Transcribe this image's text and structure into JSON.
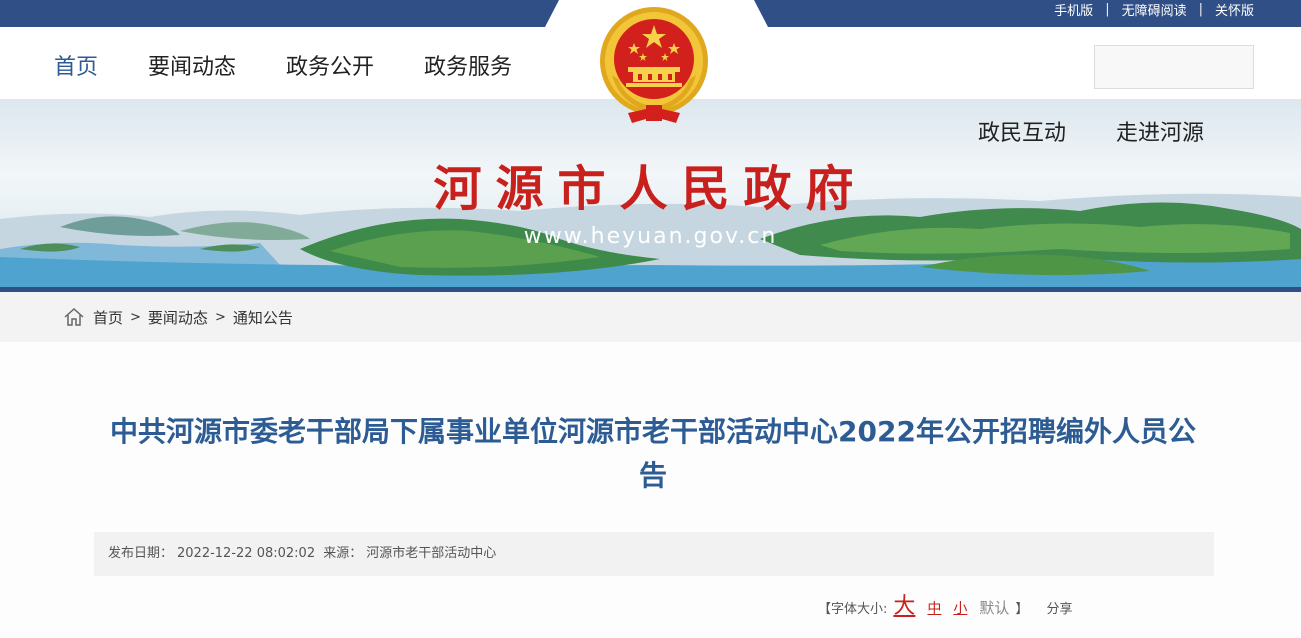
{
  "top_links": [
    "手机版",
    "无障碍阅读",
    "关怀版"
  ],
  "nav": [
    "首页",
    "要闻动态",
    "政务公开",
    "政务服务"
  ],
  "banner_links": [
    "政民互动",
    "走进河源"
  ],
  "site": {
    "title": "河源市人民政府",
    "url": "www.heyuan.gov.cn"
  },
  "breadcrumb": [
    "首页",
    "要闻动态",
    "通知公告"
  ],
  "breadcrumb_sep": ">",
  "article": {
    "title": "中共河源市委老干部局下属事业单位河源市老干部活动中心2022年公开招聘编外人员公告",
    "date_label": "发布日期：",
    "date": "2022-12-22 08:02:02",
    "source_label": "来源：",
    "source": "河源市老干部活动中心"
  },
  "font_size": {
    "label": "【字体大小:",
    "big": "大",
    "mid": "中",
    "small": "小",
    "default": "默认",
    "close": "】",
    "share": "分享"
  },
  "colors": {
    "brand_blue": "#2f4f86",
    "title_blue": "#2d5c94",
    "red": "#c8201c"
  }
}
